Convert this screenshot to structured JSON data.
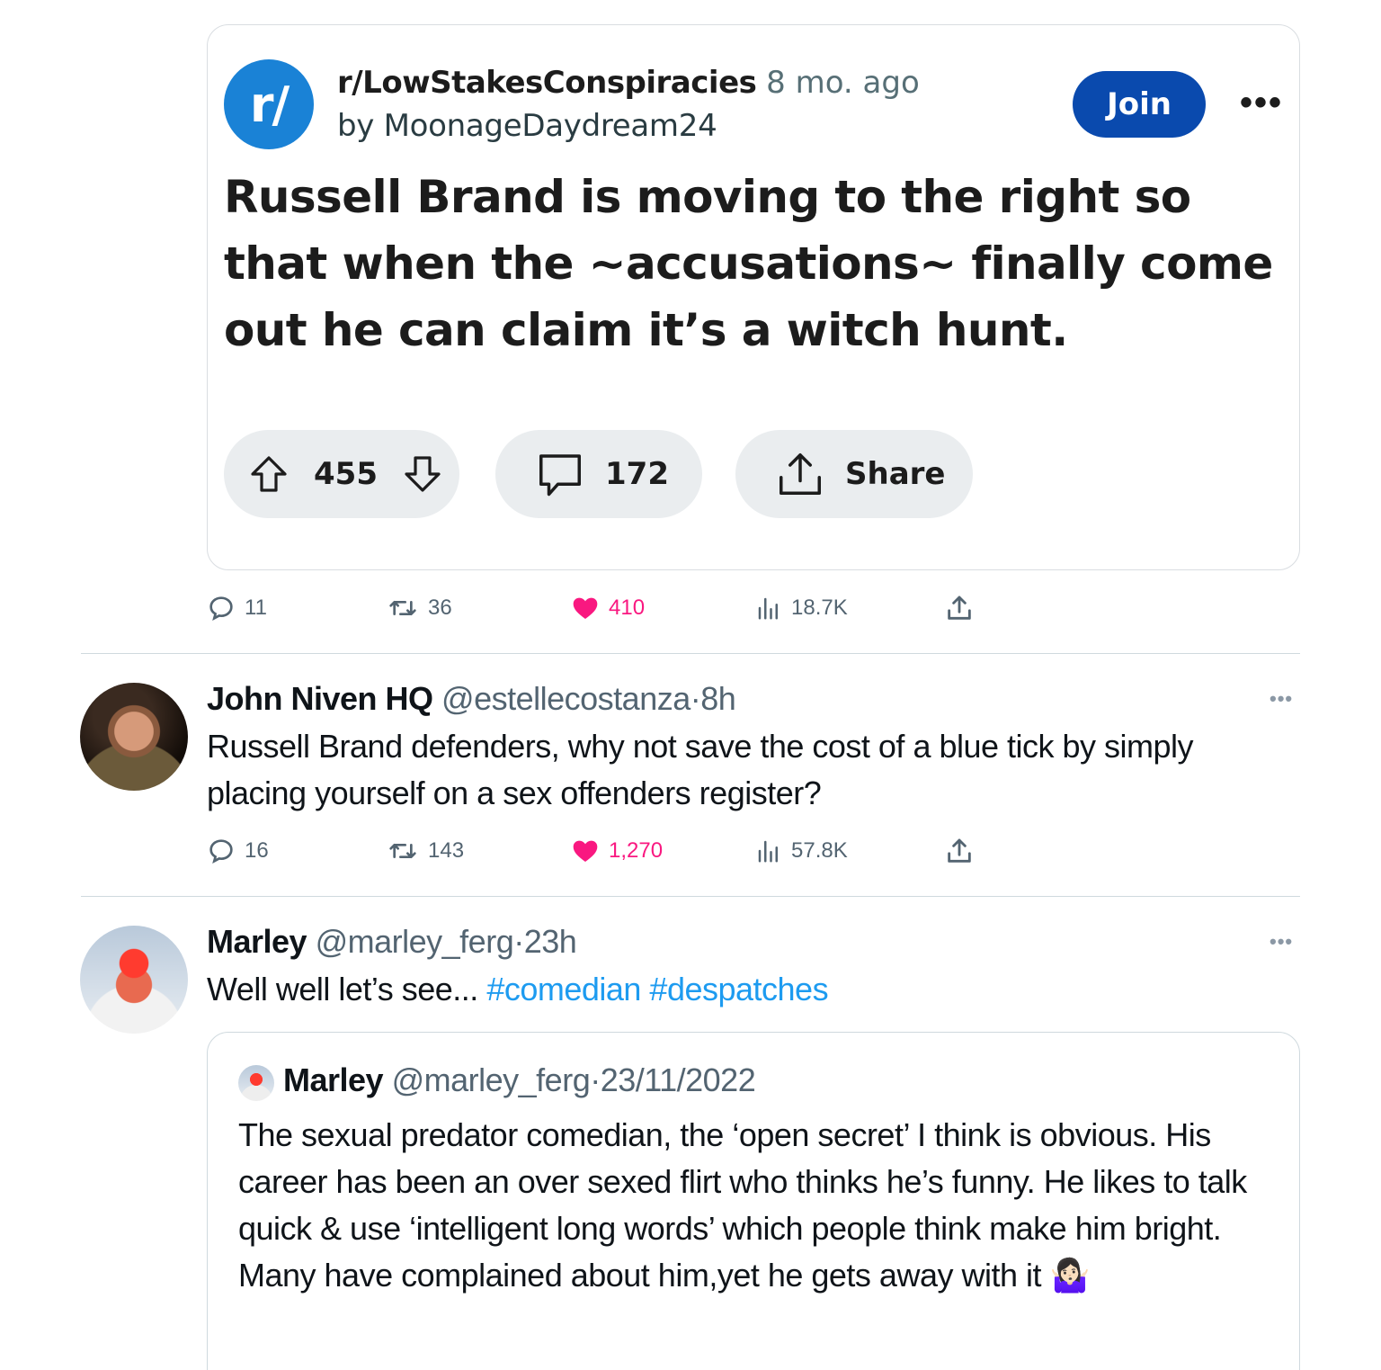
{
  "reddit_post": {
    "avatar_text": "r/",
    "subreddit": "r/LowStakesConspiracies",
    "age": "8 mo. ago",
    "author": "by MoonageDaydream24",
    "join_label": "Join",
    "more_label": "•••",
    "title": "Russell Brand is moving to the right so that when the ~accusations~ finally come out he can claim it’s a witch hunt.",
    "votes": "455",
    "comments": "172",
    "share_label": "Share",
    "colors": {
      "avatar": "#1a82d6",
      "join_button": "#0a4aae",
      "pill": "#eaedef"
    }
  },
  "tweet1_actions": {
    "replies": "11",
    "retweets": "36",
    "likes": "410",
    "views": "18.7K"
  },
  "tweet2": {
    "display_name": "John Niven HQ",
    "handle": "@estellecostanza",
    "separator": "·",
    "time": "8h",
    "text": "Russell Brand defenders, why not save the cost of a blue tick by simply placing yourself on a sex offenders register?",
    "actions": {
      "replies": "16",
      "retweets": "143",
      "likes": "1,270",
      "views": "57.8K"
    }
  },
  "tweet3": {
    "display_name": "Marley",
    "handle": "@marley_ferg",
    "separator": "·",
    "time": "23h",
    "text": "Well well let’s see...",
    "hashtags": "#comedian #despatches"
  },
  "quote": {
    "display_name": "Marley",
    "handle": "@marley_ferg",
    "separator": "·",
    "date": "23/11/2022",
    "text": "The sexual predator comedian, the ‘open secret’ I think is obvious. His career has been an over sexed flirt who thinks he’s funny. He likes to talk quick & use ‘intelligent long words’ which people think make him bright. Many have complained about him,yet he gets away with it 🤷🏻‍♀️"
  },
  "more_dots": "•••",
  "colors": {
    "like": "#f91880",
    "hashtag": "#1d9bf0",
    "muted": "#536471"
  },
  "icons": [
    "comment-icon",
    "retweet-icon",
    "heart-icon",
    "views-icon",
    "share-icon",
    "upvote-icon",
    "downvote-icon",
    "reddit-comment-icon",
    "reddit-share-icon"
  ]
}
